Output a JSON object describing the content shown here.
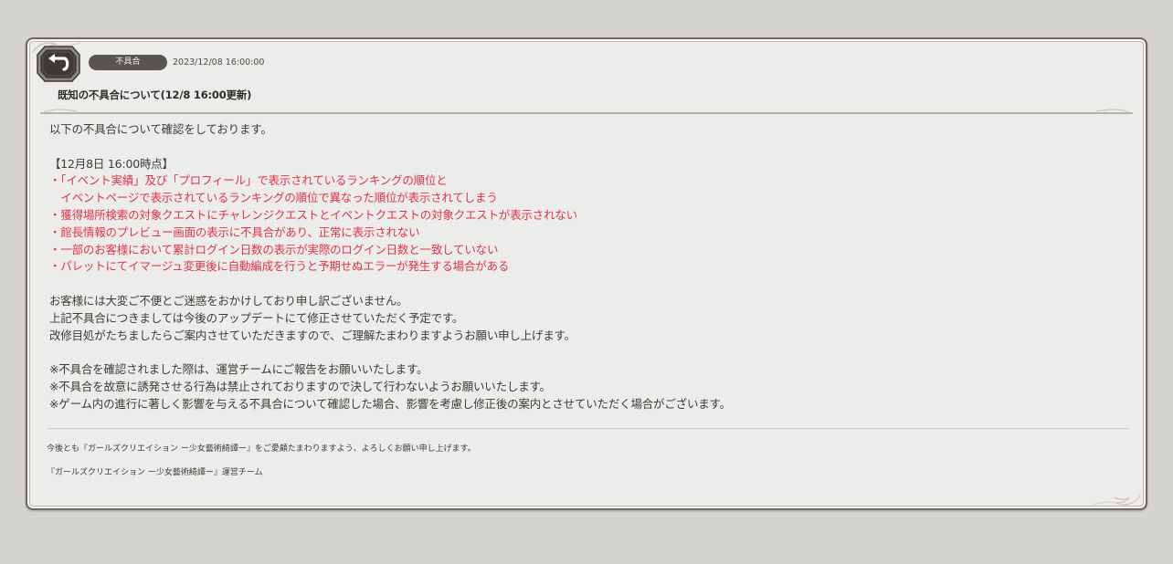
{
  "notice": {
    "category": "不具合",
    "date": "2023/12/08 16:00:00",
    "title": "既知の不具合について(12/8 16:00更新)"
  },
  "body": {
    "intro": "以下の不具合について確認をしております。",
    "section_heading": "【12月8日 16:00時点】",
    "issues": [
      "・「イベント実績」及び「プロフィール」で表示されているランキングの順位と",
      "　イベントページで表示されているランキングの順位で異なった順位が表示されてしまう",
      "・獲得場所検索の対象クエストにチャレンジクエストとイベントクエストの対象クエストが表示されない",
      "・館長情報のプレビュー画面の表示に不具合があり、正常に表示されない",
      "・一部のお客様において累計ログイン日数の表示が実際のログイン日数と一致していない",
      "・パレットにてイマージュ変更後に自動編成を行うと予期せぬエラーが発生する場合がある"
    ],
    "apology": [
      "お客様には大変ご不便とご迷惑をおかけしており申し訳ございません。",
      "上記不具合につきましては今後のアップデートにて修正させていただく予定です。",
      "改修目処がたちましたらご案内させていただきますので、ご理解たまわりますようお願い申し上げます。"
    ],
    "notes": [
      "※不具合を確認されました際は、運営チームにご報告をお願いいたします。",
      "※不具合を故意に誘発させる行為は禁止されておりますので決して行わないようお願いいたします。",
      "※ゲーム内の進行に著しく影響を与える不具合について確認した場合、影響を考慮し修正後の案内とさせていただく場合がございます。"
    ]
  },
  "footer": {
    "closing": "今後とも『ガールズクリエイション ー少女藝術綺譚ー』をご愛顧たまわりますよう、よろしくお願い申し上げます。",
    "signature": "『ガールズクリエイション ー少女藝術綺譚ー』運営チーム"
  },
  "colors": {
    "accent_red": "#e0334a",
    "badge_bg": "#5b5550",
    "panel_bg": "#ececea",
    "page_bg": "#d5d4ce"
  },
  "icons": {
    "back": "back-arrow-icon"
  }
}
